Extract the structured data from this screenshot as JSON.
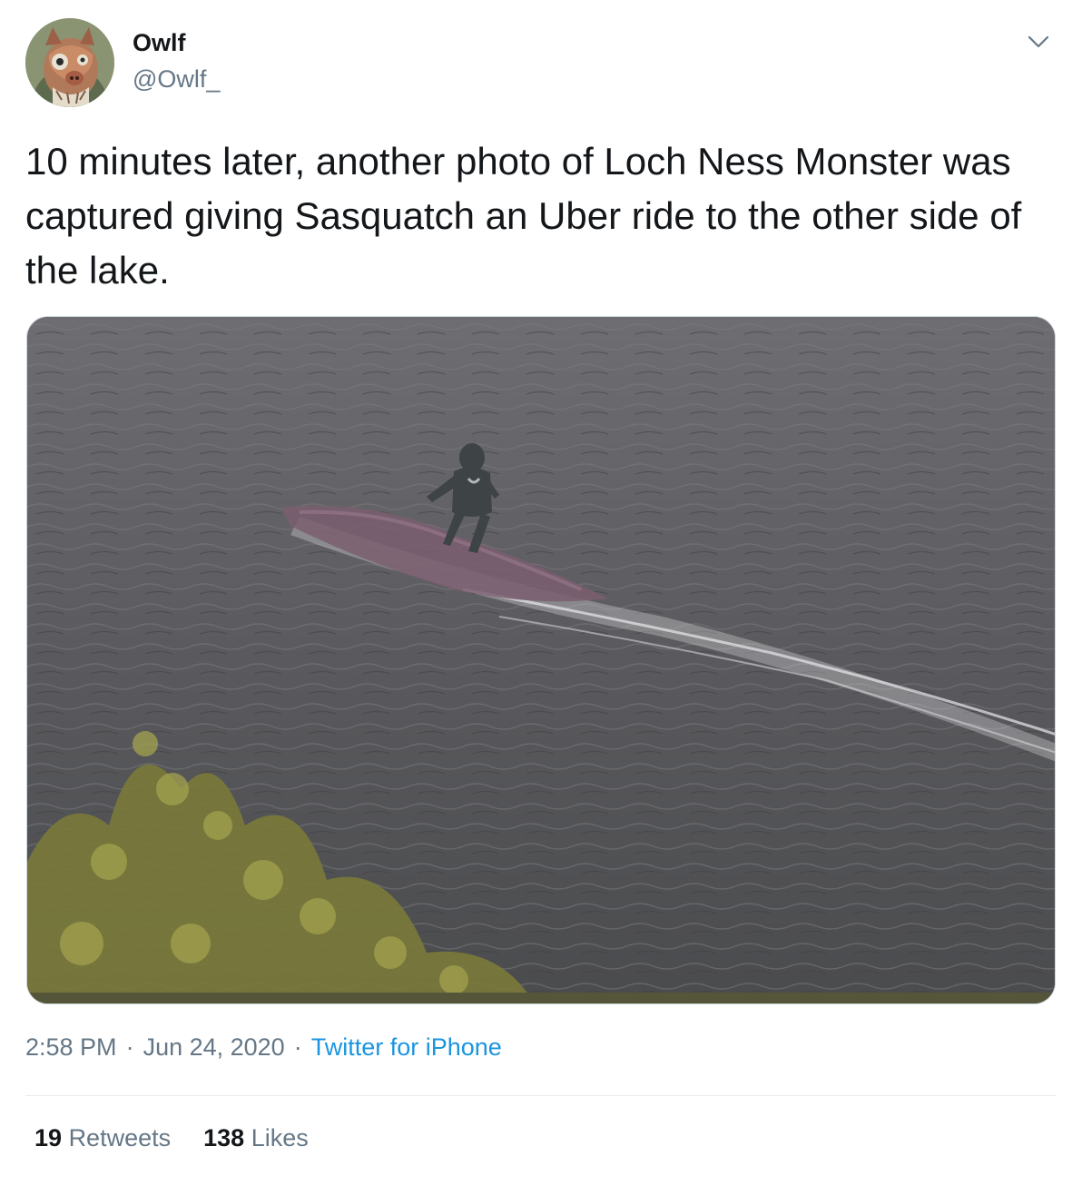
{
  "tweet": {
    "author": {
      "display_name": "Owlf",
      "handle": "@Owlf_"
    },
    "text": "10 minutes later, another photo of Loch Ness Monster was captured giving Sasquatch an Uber ride to the other side of the lake.",
    "time": "2:58 PM",
    "date": "Jun 24, 2020",
    "separator": "·",
    "source": "Twitter for iPhone",
    "stats": {
      "retweets_count": "19",
      "retweets_label": "Retweets",
      "likes_count": "138",
      "likes_label": "Likes"
    }
  },
  "icons": {
    "menu": "chevron-down-icon"
  },
  "colors": {
    "text_primary": "#14171a",
    "text_secondary": "#657786",
    "link": "#1b95e0",
    "divider": "#e6ecf0"
  }
}
